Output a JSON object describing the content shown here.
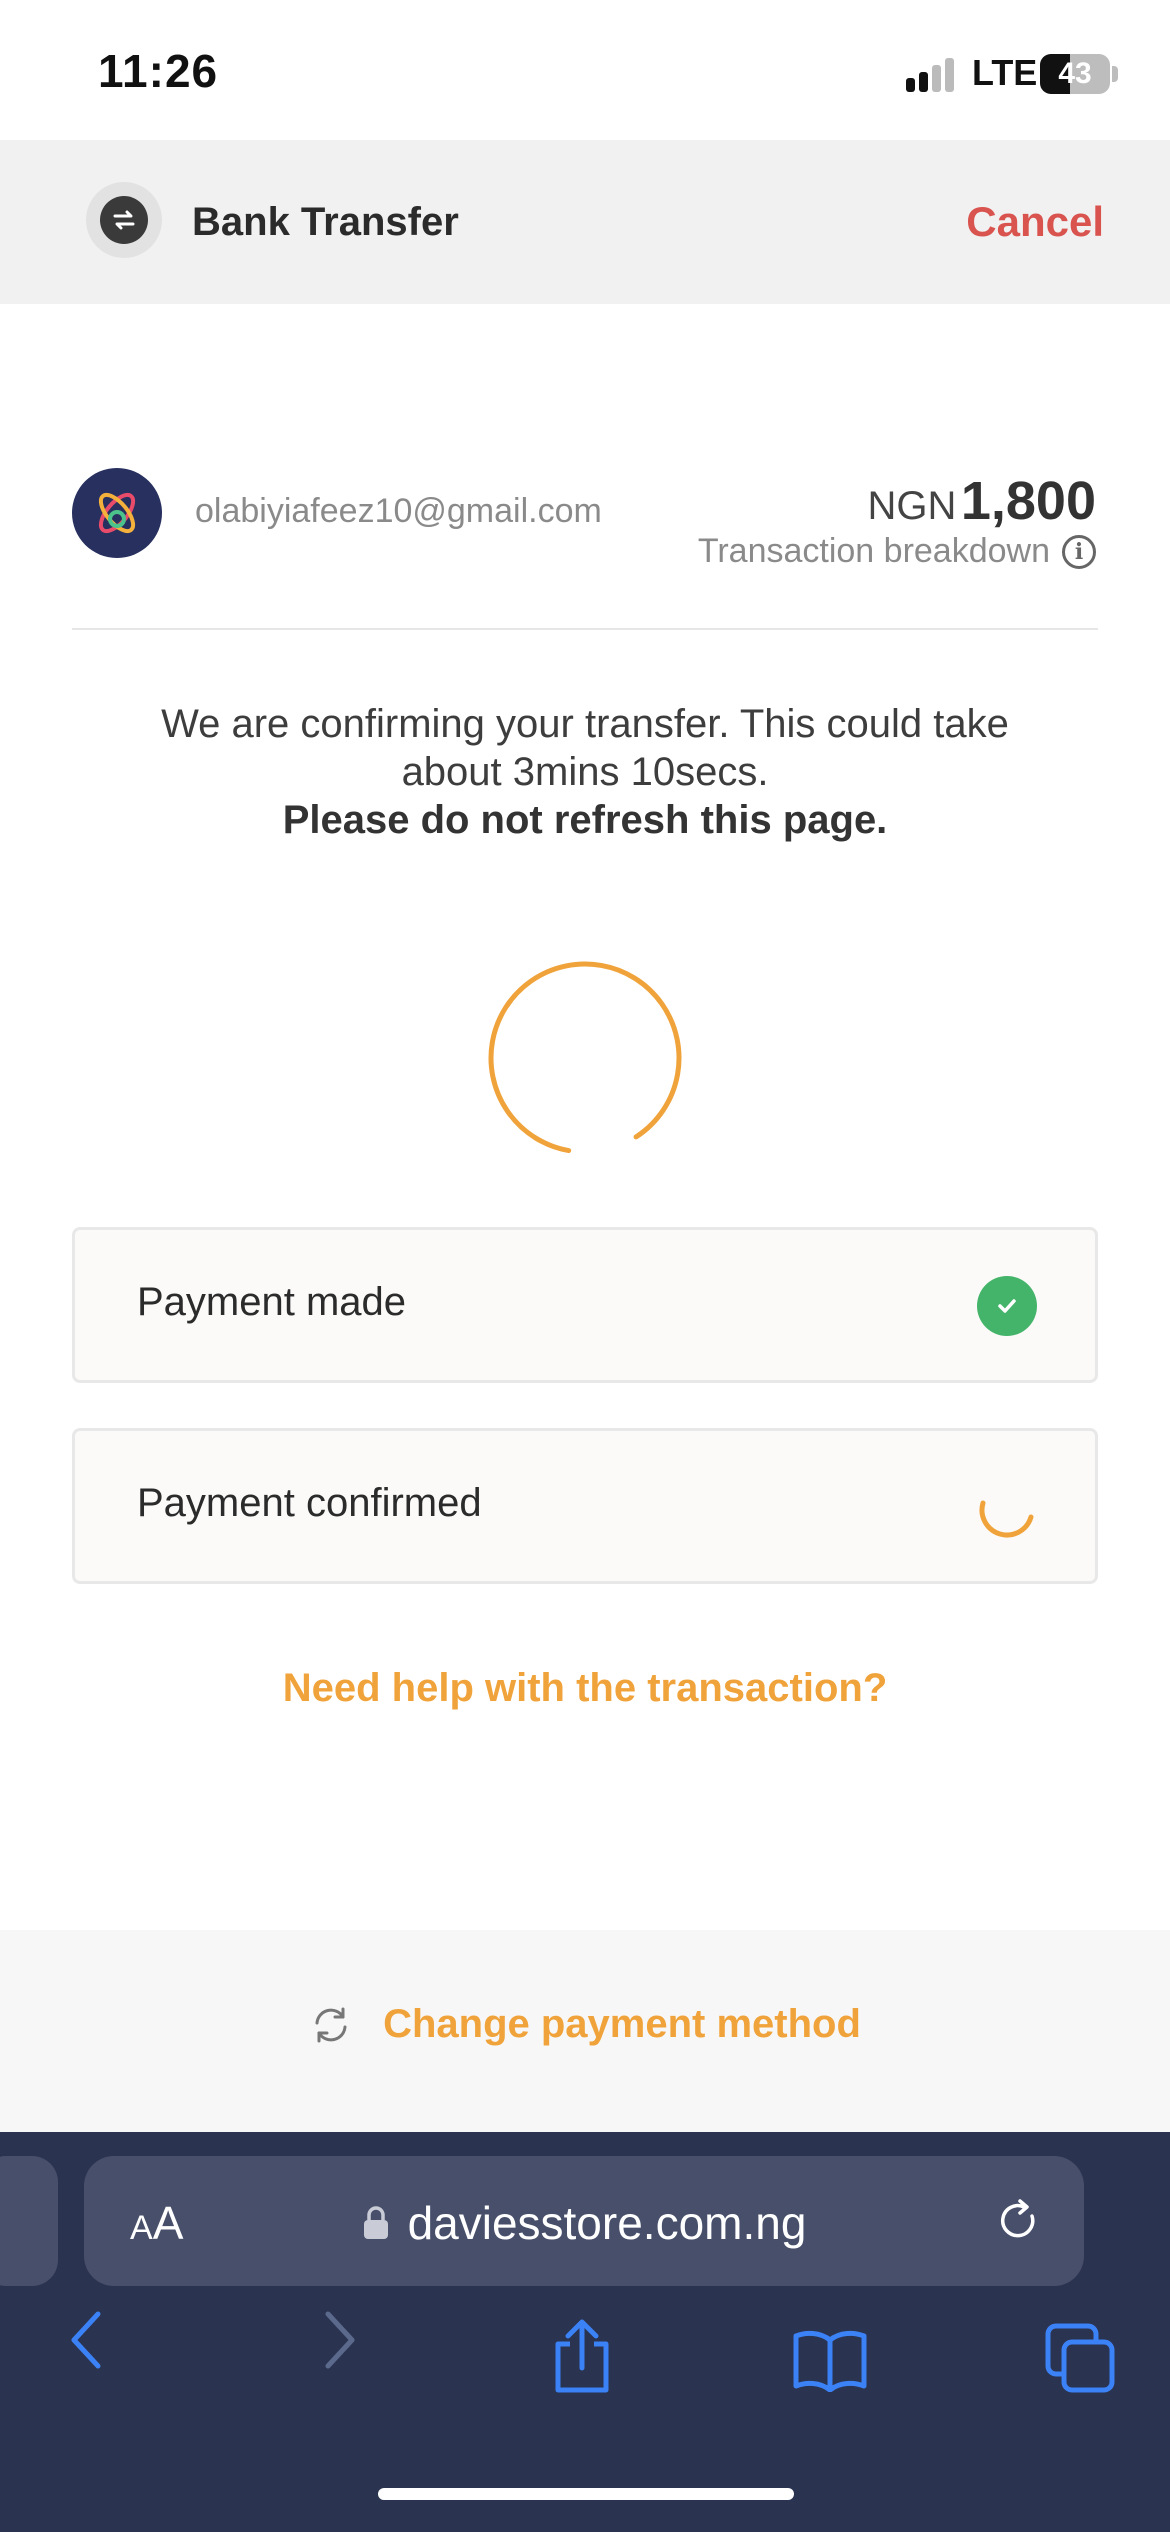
{
  "status_bar": {
    "time": "11:26",
    "network": "LTE",
    "battery": "43"
  },
  "header": {
    "title": "Bank Transfer",
    "cancel_label": "Cancel"
  },
  "merchant": {
    "email": "olabiyiafeez10@gmail.com",
    "currency": "NGN",
    "amount": "1,800",
    "breakdown_label": "Transaction breakdown"
  },
  "message": {
    "line1": "We are confirming your transfer. This could take about 3mins 10secs.",
    "line2": "Please do not refresh this page."
  },
  "steps": [
    {
      "label": "Payment made",
      "state": "done"
    },
    {
      "label": "Payment confirmed",
      "state": "pending"
    }
  ],
  "help_link": "Need help with the transaction?",
  "footer": {
    "change_method_label": "Change payment method"
  },
  "browser": {
    "aa_small": "A",
    "aa_large": "A",
    "url": "daviesstore.com.ng"
  },
  "colors": {
    "accent": "#f0a33a",
    "cancel": "#d9534f",
    "success": "#44b46a",
    "safari_bg": "#2a3350"
  }
}
